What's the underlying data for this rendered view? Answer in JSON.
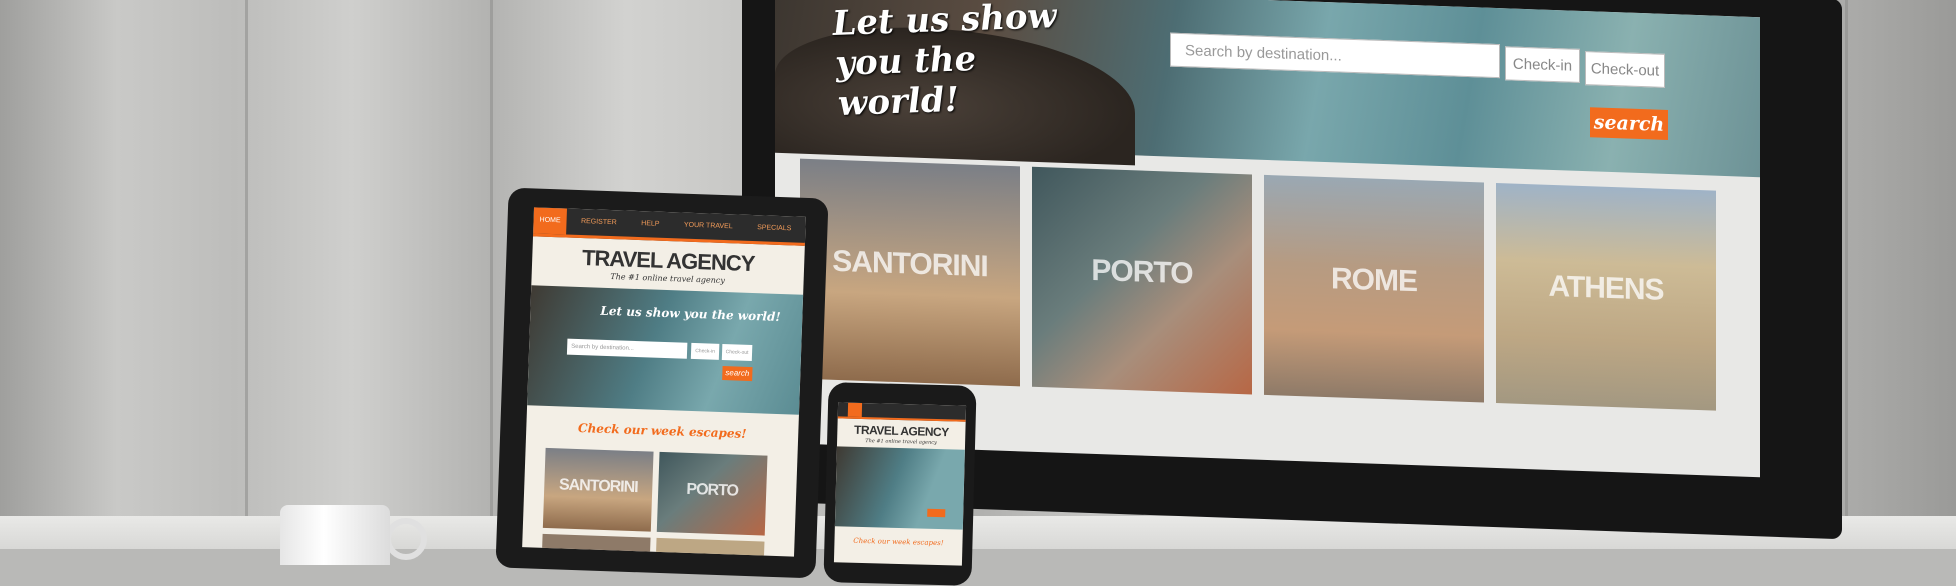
{
  "desktop": {
    "tagline": "Let us show you the world!",
    "search_placeholder": "Search by destination...",
    "checkin": "Check-in",
    "checkout": "Check-out",
    "search_button": "search",
    "destinations": [
      "SANTORINI",
      "PORTO",
      "ROME",
      "ATHENS"
    ]
  },
  "tablet": {
    "nav": [
      "HOME",
      "REGISTER",
      "HELP",
      "YOUR TRAVEL",
      "SPECIALS"
    ],
    "title": "TRAVEL AGENCY",
    "subtitle": "The #1 online travel agency",
    "tagline": "Let us show you the world!",
    "search_placeholder": "Search by destination...",
    "checkin": "Check-in",
    "checkout": "Check-out",
    "search_button": "search",
    "heading": "Check our week escapes!",
    "destinations": [
      "SANTORINI",
      "PORTO"
    ]
  },
  "phone": {
    "title": "TRAVEL AGENCY",
    "subtitle": "The #1 online travel agency",
    "heading": "Check our week escapes!"
  },
  "colors": {
    "accent": "#f26b1d",
    "nav": "#2c2c2c"
  }
}
